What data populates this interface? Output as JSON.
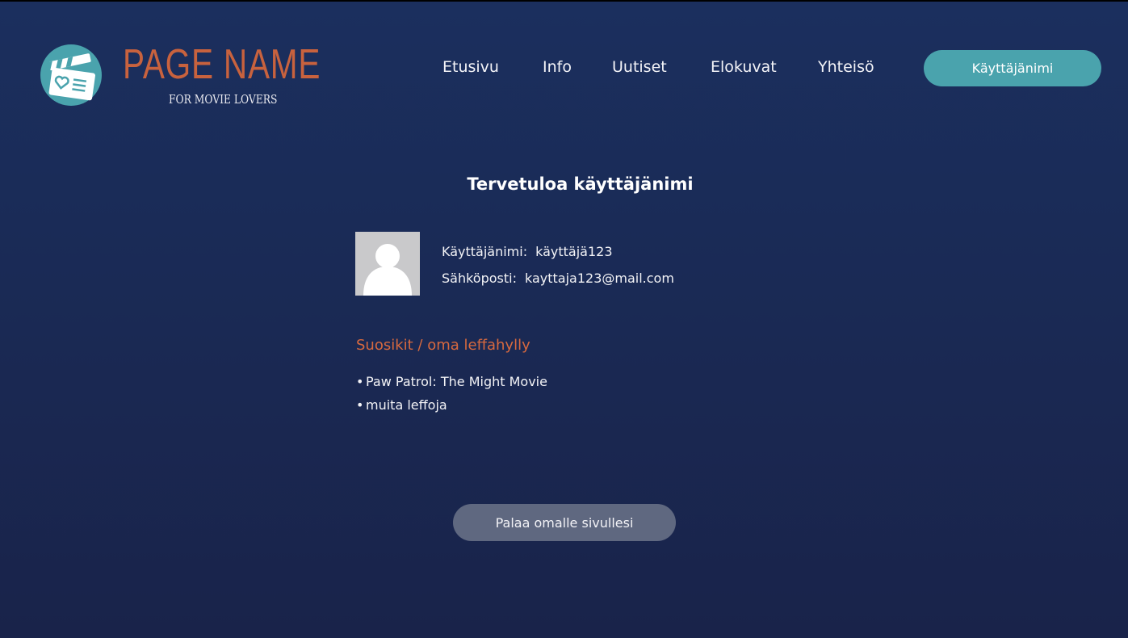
{
  "logo": {
    "title": "PAGE NAME",
    "subtitle": "FOR MOVIE LOVERS",
    "icon": "clapperboard-heart-icon",
    "title_color": "#c8623e",
    "icon_bg": "#4aa3ad"
  },
  "nav": {
    "items": [
      {
        "label": "Etusivu"
      },
      {
        "label": "Info"
      },
      {
        "label": "Uutiset"
      },
      {
        "label": "Elokuvat"
      },
      {
        "label": "Yhteisö"
      }
    ],
    "user_button": "Käyttäjänimi"
  },
  "main": {
    "title": "Tervetuloa käyttäjänimi",
    "profile": {
      "avatar_icon": "user-silhouette-icon",
      "username_label": "Käyttäjänimi:",
      "username_value": "käyttäjä123",
      "email_label": "Sähköposti:",
      "email_value": "kayttaja123@mail.com"
    },
    "favorites": {
      "heading": "Suosikit / oma leffahylly",
      "items": [
        "Paw Patrol: The Might Movie",
        "muita leffoja"
      ]
    },
    "back_button": "Palaa omalle sivullesi"
  },
  "colors": {
    "background_top": "#1b2f5e",
    "background_bottom": "#19234a",
    "accent_teal": "#4aa3ad",
    "accent_orange": "#d7693f",
    "button_gray": "#5f6880"
  }
}
